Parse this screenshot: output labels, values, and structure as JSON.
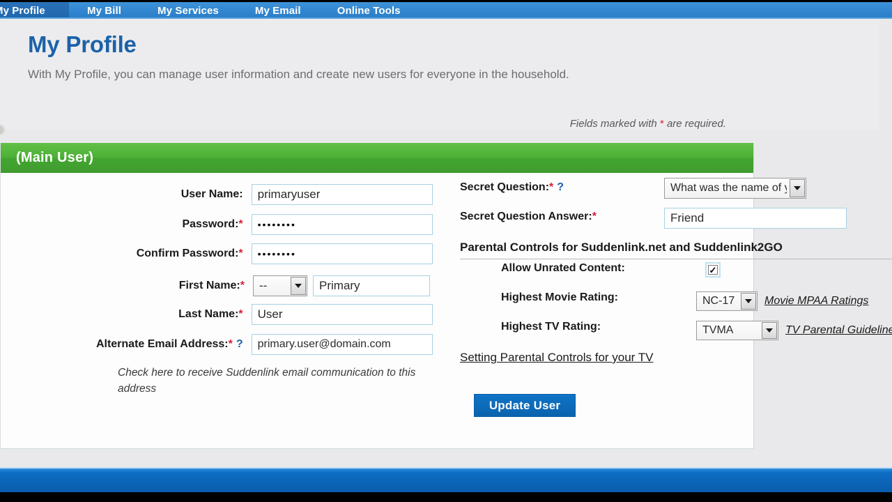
{
  "nav": {
    "tabs": [
      {
        "label": "My Profile",
        "active": true
      },
      {
        "label": "My Bill",
        "active": false
      },
      {
        "label": "My Services",
        "active": false
      },
      {
        "label": "My Email",
        "active": false
      },
      {
        "label": "Online Tools",
        "active": false
      }
    ]
  },
  "header": {
    "title": "My Profile",
    "subtitle": "With My Profile, you can manage user information and create new users for everyone in the household.",
    "required_note_before": "Fields marked with ",
    "required_note_star": "*",
    "required_note_after": " are required."
  },
  "panel": {
    "banner": "(Main User)"
  },
  "left_form": {
    "rows": [
      {
        "label": "User Name:",
        "required": false,
        "value": "primaryuser"
      },
      {
        "label": "Password:",
        "required": true,
        "value": "••••••••"
      },
      {
        "label": "Confirm Password:",
        "required": true,
        "value": "••••••••"
      }
    ],
    "name_row": {
      "label": "First Name:",
      "required": true,
      "title_select": "--",
      "first_name": "Primary"
    },
    "last_name_row": {
      "label": "Last Name:",
      "required": true,
      "value": "User"
    },
    "email_row": {
      "label": "Alternate Email Address:",
      "required": true,
      "help": "?",
      "value": "primary.user@domain.com"
    },
    "opt_in_note": "Check here to receive Suddenlink email communication to this address"
  },
  "right_form": {
    "secret_question_label": "Secret Question:",
    "secret_question_help": "?",
    "secret_question_value": "What was the name of your best child",
    "secret_answer_label": "Secret Question Answer:",
    "secret_answer_value": "Friend",
    "parental_section_title": "Parental Controls for Suddenlink.net and Suddenlink2GO",
    "unrated_label": "Allow Unrated Content:",
    "unrated_checked": true,
    "movie_rating_label": "Highest Movie Rating:",
    "movie_rating_value": "NC-17",
    "movie_rating_link": "Movie MPAA Ratings",
    "tv_rating_label": "Highest TV Rating:",
    "tv_rating_value": "TVMA",
    "tv_rating_link": "TV Parental Guidelines",
    "parental_tv_link": "Setting Parental Controls for your TV",
    "submit_label": "Update User"
  }
}
